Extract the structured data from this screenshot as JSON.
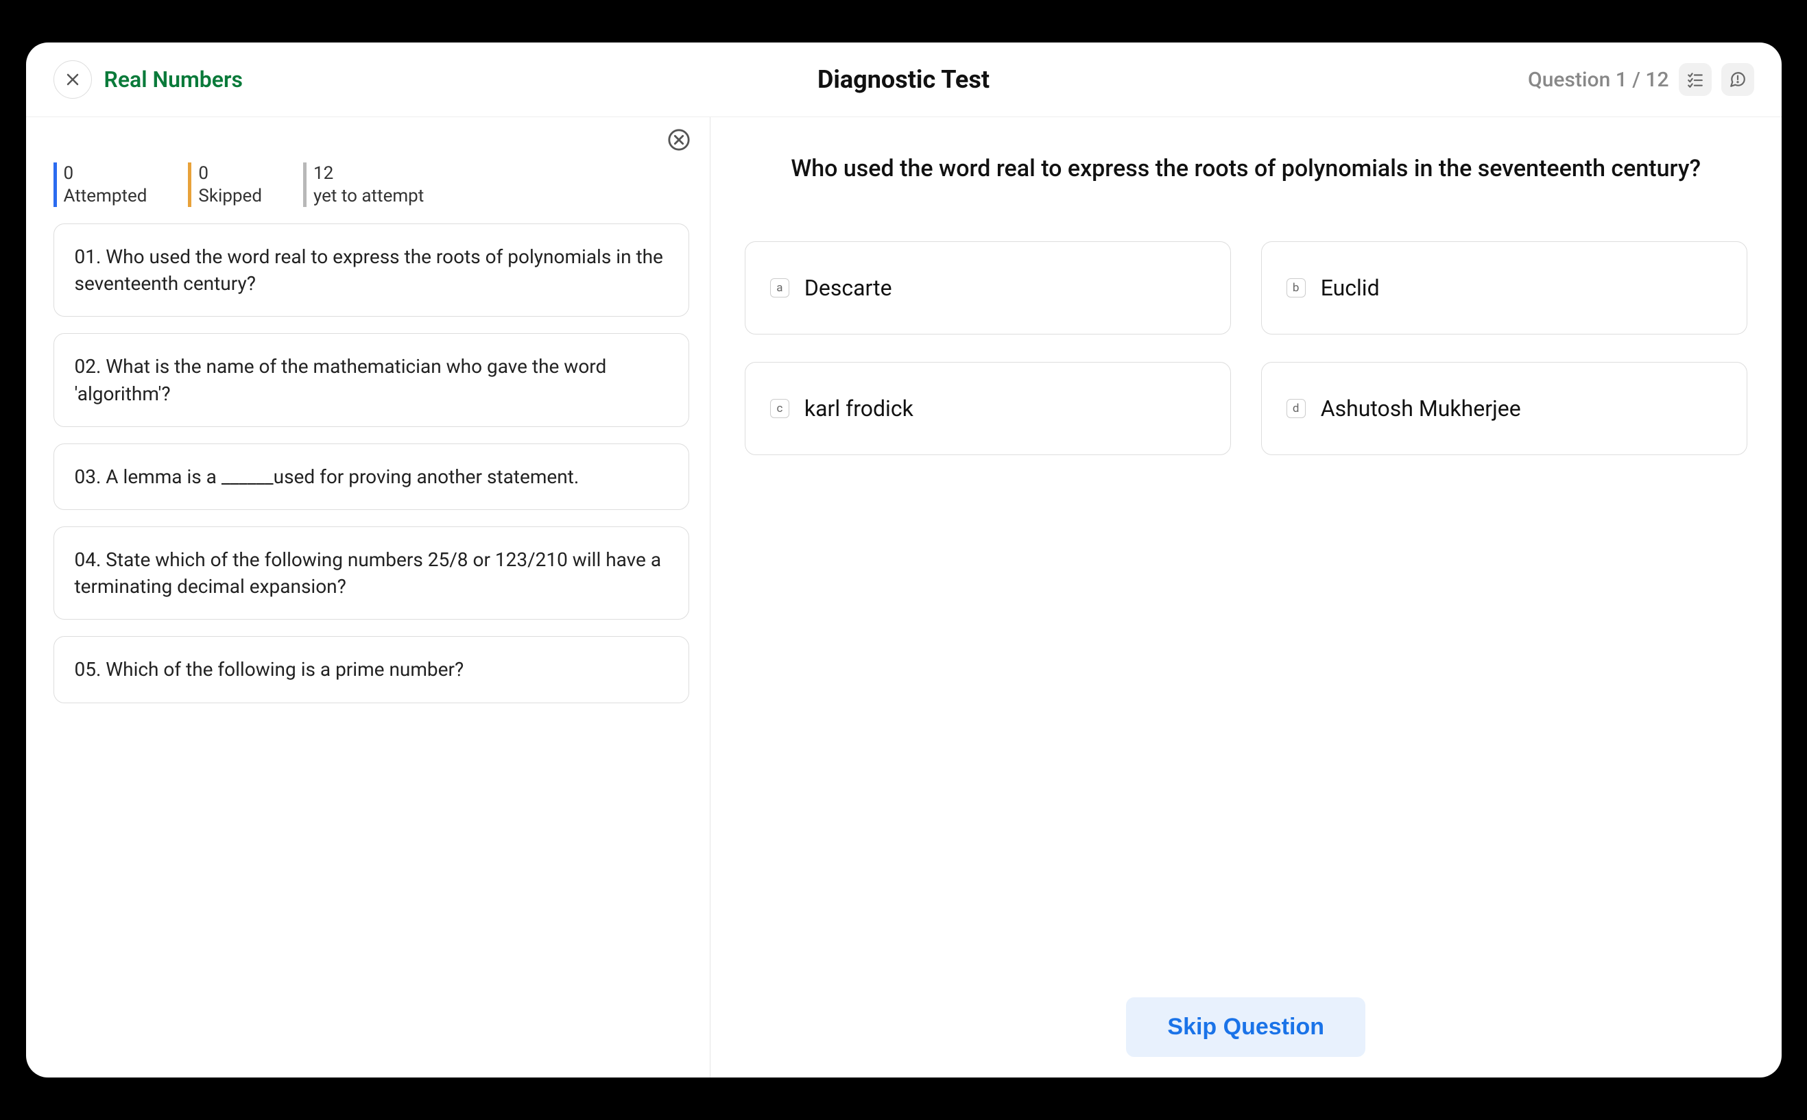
{
  "header": {
    "topic": "Real Numbers",
    "title": "Diagnostic Test",
    "counter": "Question 1 / 12"
  },
  "stats": {
    "attempted": {
      "value": "0",
      "label": "Attempted"
    },
    "skipped": {
      "value": "0",
      "label": "Skipped"
    },
    "yet": {
      "value": "12",
      "label": "yet to attempt"
    }
  },
  "questions": [
    {
      "num": "01.",
      "text": "Who used the word real to express the roots of polynomials in the seventeenth century?"
    },
    {
      "num": "02.",
      "text": "What is the name of the mathematician who gave the word 'algorithm'?"
    },
    {
      "num": "03.",
      "text": "A lemma is a ______used for proving another statement."
    },
    {
      "num": "04.",
      "text": "State which of the following numbers 25/8 or 123/210 will have a terminating decimal expansion?"
    },
    {
      "num": "05.",
      "text": "Which of the following is a prime number?"
    }
  ],
  "current": {
    "text": "Who used the word real to express the roots of polynomials in the seventeenth century?",
    "options": [
      {
        "letter": "a",
        "text": "Descarte"
      },
      {
        "letter": "b",
        "text": "Euclid"
      },
      {
        "letter": "c",
        "text": "karl frodick"
      },
      {
        "letter": "d",
        "text": "Ashutosh Mukherjee"
      }
    ]
  },
  "buttons": {
    "skip": "Skip Question"
  }
}
